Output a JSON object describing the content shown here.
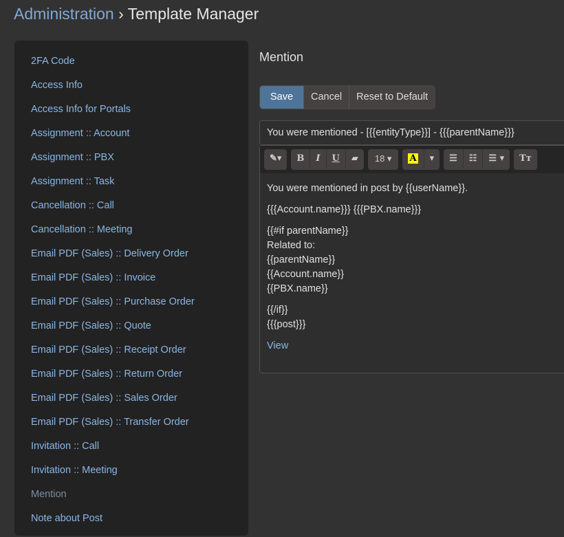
{
  "header": {
    "crumb": "Administration",
    "sep": " › ",
    "title": "Template Manager"
  },
  "sidebar": {
    "items": [
      "2FA Code",
      "Access Info",
      "Access Info for Portals",
      "Assignment :: Account",
      "Assignment :: PBX",
      "Assignment :: Task",
      "Cancellation :: Call",
      "Cancellation :: Meeting",
      "Email PDF (Sales) :: Delivery Order",
      "Email PDF (Sales) :: Invoice",
      "Email PDF (Sales) :: Purchase Order",
      "Email PDF (Sales) :: Quote",
      "Email PDF (Sales) :: Receipt Order",
      "Email PDF (Sales) :: Return Order",
      "Email PDF (Sales) :: Sales Order",
      "Email PDF (Sales) :: Transfer Order",
      "Invitation :: Call",
      "Invitation :: Meeting",
      "Mention",
      "Note about Post"
    ],
    "active": "Mention"
  },
  "main": {
    "heading": "Mention",
    "save": "Save",
    "cancel": "Cancel",
    "reset": "Reset to Default",
    "subject": "You were mentioned - [{{entityType}}] - {{{parentName}}}",
    "toolbar": {
      "magic": "✎▾",
      "bold": "B",
      "italic": "I",
      "underline": "U",
      "eraser": "▰",
      "fontsize": "18 ▾",
      "color": "A",
      "color_caret": "▾",
      "ul": "☰",
      "ol": "☷",
      "align": "☰ ▾",
      "style": "Tт"
    },
    "body": {
      "l1": "You were mentioned in post by {{userName}}.",
      "l2": "{{{Account.name}}} {{{PBX.name}}}",
      "l3": "{{#if parentName}}",
      "l4": "Related to:",
      "l5": "{{parentName}}",
      "l6": "{{Account.name}}",
      "l7": "{{PBX.name}}",
      "l8": "{{/if}}",
      "l9": "{{{post}}}",
      "link": "View"
    }
  }
}
